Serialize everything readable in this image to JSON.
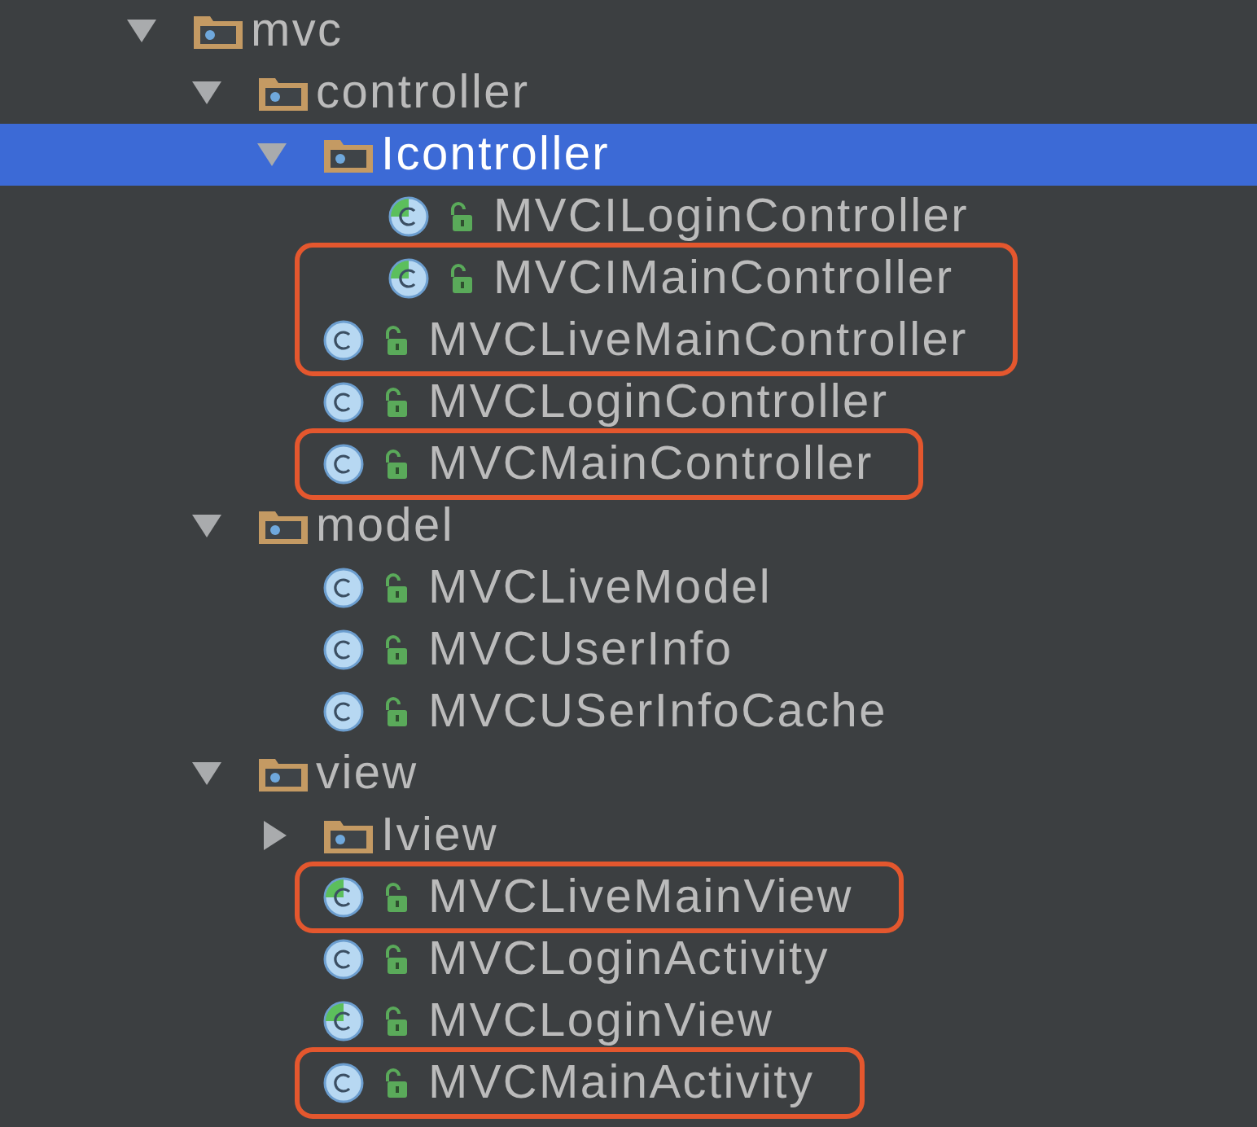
{
  "tree": [
    {
      "kind": "package",
      "label": "mvc",
      "expanded": true,
      "selected": false,
      "children": [
        {
          "kind": "package",
          "label": "controller",
          "expanded": true,
          "selected": false,
          "children": [
            {
              "kind": "package",
              "label": "Icontroller",
              "expanded": true,
              "selected": true,
              "children": [
                {
                  "kind": "interface",
                  "label": "MVCILoginController",
                  "selected": false,
                  "boxed": false
                },
                {
                  "kind": "interface",
                  "label": "MVCIMainController",
                  "selected": false,
                  "boxed": true
                }
              ]
            },
            {
              "kind": "class",
              "label": "MVCLiveMainController",
              "selected": false,
              "boxed": true
            },
            {
              "kind": "class",
              "label": "MVCLoginController",
              "selected": false,
              "boxed": false
            },
            {
              "kind": "class",
              "label": "MVCMainController",
              "selected": false,
              "boxed": true
            }
          ]
        },
        {
          "kind": "package",
          "label": "model",
          "expanded": true,
          "selected": false,
          "children": [
            {
              "kind": "class",
              "label": "MVCLiveModel",
              "selected": false,
              "boxed": false
            },
            {
              "kind": "class",
              "label": "MVCUserInfo",
              "selected": false,
              "boxed": false
            },
            {
              "kind": "class",
              "label": "MVCUSerInfoCache",
              "selected": false,
              "boxed": false
            }
          ]
        },
        {
          "kind": "package",
          "label": "view",
          "expanded": true,
          "selected": false,
          "children": [
            {
              "kind": "package",
              "label": "Iview",
              "expanded": false,
              "selected": false
            },
            {
              "kind": "interface",
              "label": "MVCLiveMainView",
              "selected": false,
              "boxed": true
            },
            {
              "kind": "class",
              "label": "MVCLoginActivity",
              "selected": false,
              "boxed": false
            },
            {
              "kind": "interface",
              "label": "MVCLoginView",
              "selected": false,
              "boxed": false
            },
            {
              "kind": "class",
              "label": "MVCMainActivity",
              "selected": false,
              "boxed": true
            }
          ]
        }
      ]
    }
  ]
}
